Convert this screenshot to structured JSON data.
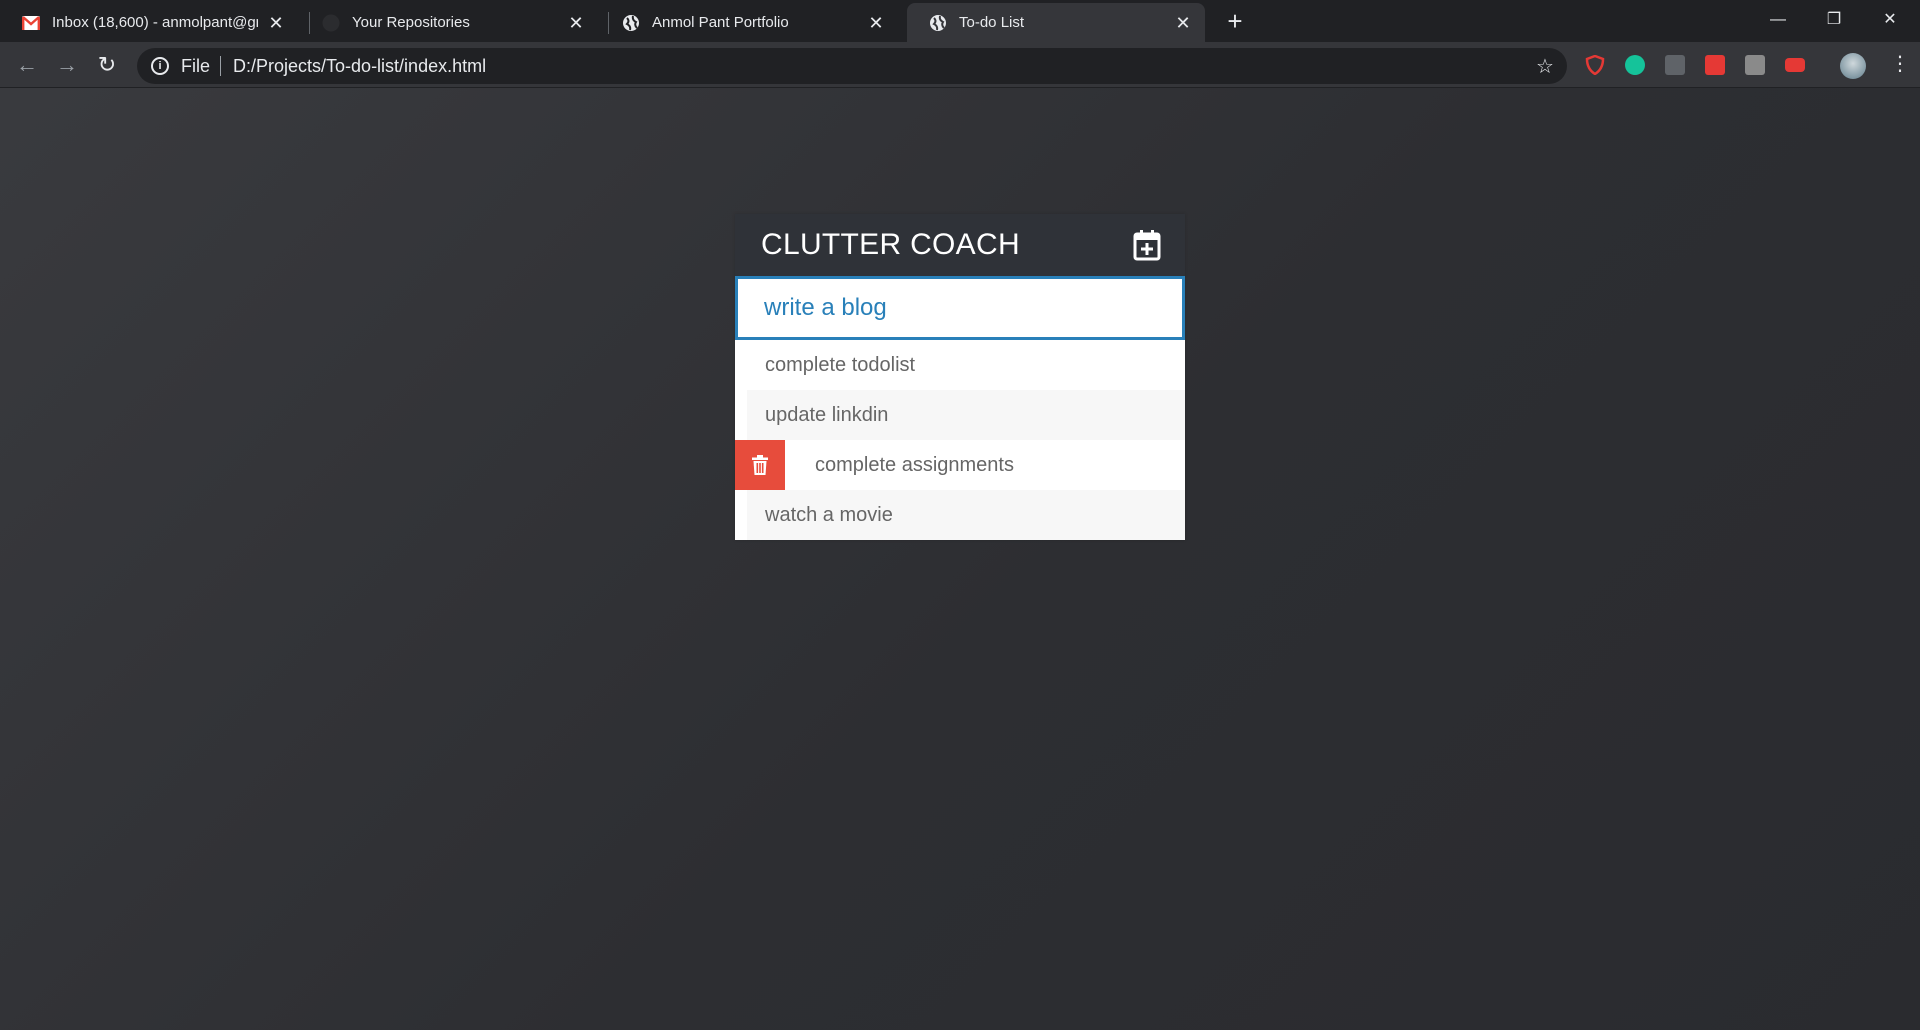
{
  "browser": {
    "tabs": [
      {
        "title": "Inbox (18,600) - anmolpant@gm",
        "icon": "gmail-icon",
        "active": false
      },
      {
        "title": "Your Repositories",
        "icon": "github-icon",
        "active": false
      },
      {
        "title": "Anmol Pant Portfolio",
        "icon": "globe-icon",
        "active": false
      },
      {
        "title": "To-do List",
        "icon": "globe-icon",
        "active": true
      }
    ],
    "tab_close_glyph": "✕",
    "new_tab_glyph": "+",
    "address": {
      "scheme_label": "File",
      "url": "D:/Projects/To-do-list/index.html"
    },
    "extensions": [
      "ublock-icon",
      "grammarly-icon",
      "pdf-icon",
      "highlighter-icon",
      "e-extension-icon",
      "youtube-extension-icon"
    ]
  },
  "app": {
    "title": "CLUTTER COACH",
    "input_value": "write a blog",
    "items": [
      {
        "text": "complete todolist"
      },
      {
        "text": "update linkdin"
      },
      {
        "text": "complete assignments"
      },
      {
        "text": "watch a movie"
      }
    ]
  },
  "colors": {
    "header_bg": "#2f3238",
    "accent_blue": "#2980b9",
    "delete_red": "#e74c3c",
    "page_bg": "#36373b"
  }
}
